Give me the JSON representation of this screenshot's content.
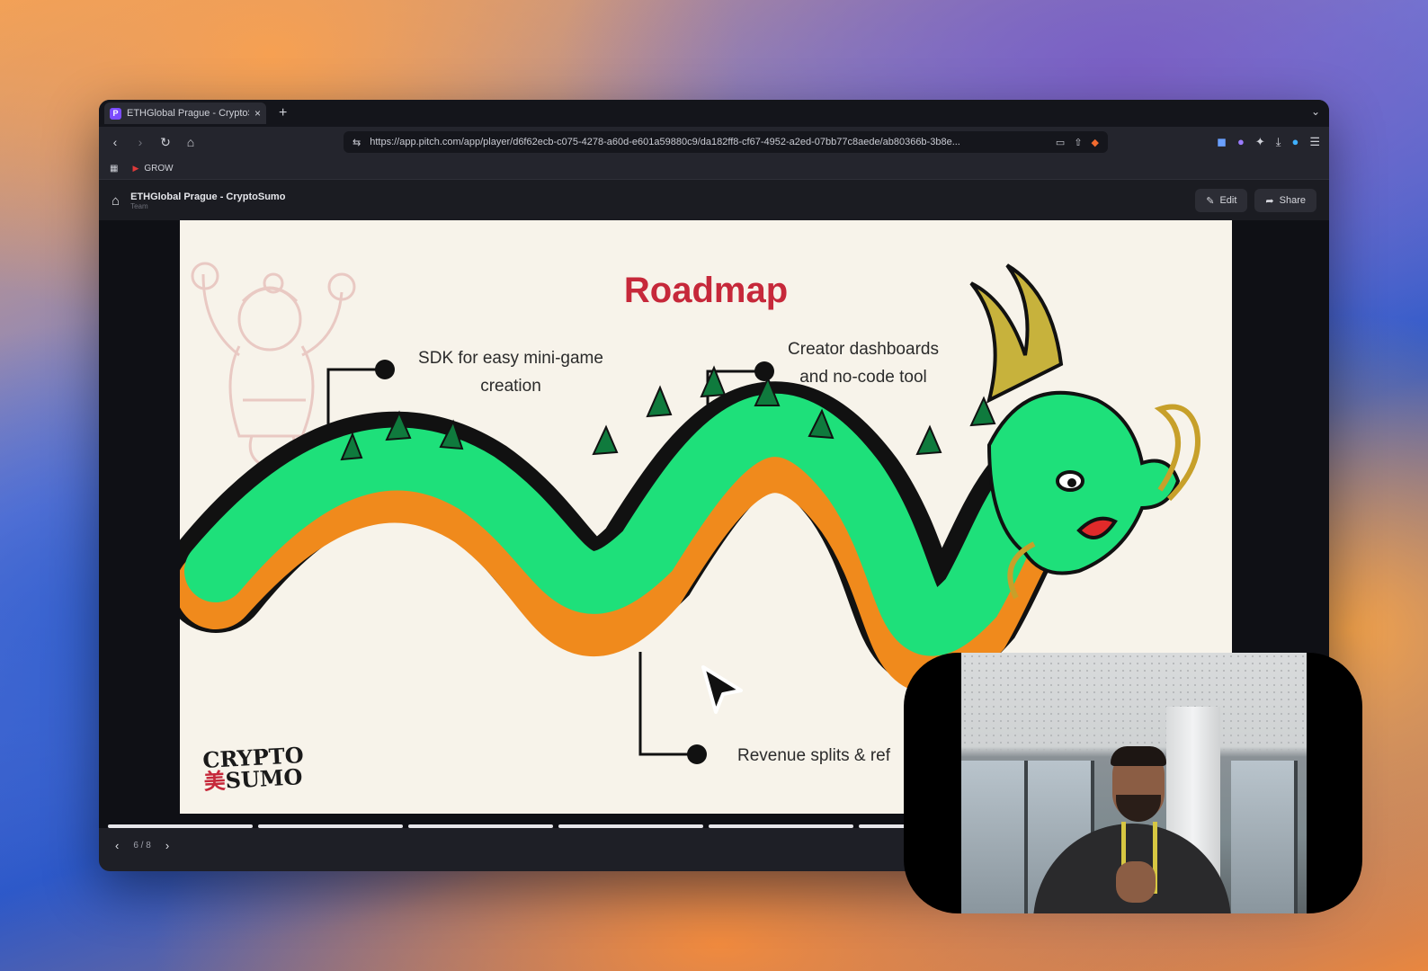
{
  "browser": {
    "tab_title": "ETHGlobal Prague - CryptoSumo",
    "tab_close": "×",
    "new_tab": "+",
    "url": "https://app.pitch.com/app/player/d6f62ecb-c075-4278-a60d-e601a59880c9/da182ff8-cf67-4952-a2ed-07bb77c8aede/ab80366b-3b8e...",
    "bookmark": "GROW"
  },
  "pitch": {
    "title": "ETHGlobal Prague - CryptoSumo",
    "subtitle": "Team",
    "edit_label": "Edit",
    "share_label": "Share"
  },
  "slide": {
    "title": "Roadmap",
    "milestones": [
      {
        "text": "SDK for easy mini-game creation"
      },
      {
        "text": "Creator dashboards and no-code tool"
      },
      {
        "text": "Revenue splits & ref"
      }
    ],
    "logo_line1": "CRYPTO",
    "logo_line2": "SUMO",
    "logo_mark": "美"
  },
  "player": {
    "counter": "6 / 8",
    "total_slides": 8,
    "current_slide": 6
  },
  "colors": {
    "title_red": "#c6283a",
    "dragon_green": "#1ee07a",
    "dragon_orange": "#f08a1c",
    "slide_bg": "#f7f3ea"
  }
}
